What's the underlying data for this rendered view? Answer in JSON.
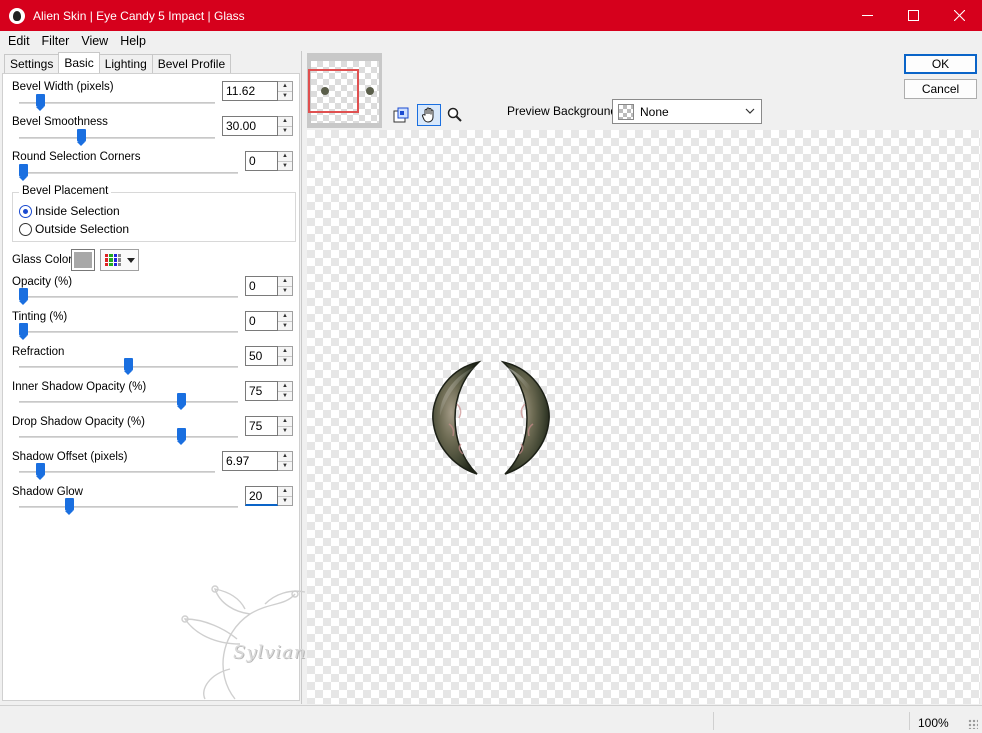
{
  "window": {
    "title": "Alien Skin | Eye Candy 5 Impact | Glass",
    "minimize_icon": "minimize-icon",
    "maximize_icon": "maximize-icon",
    "close_icon": "close-icon",
    "accent_color": "#d6001c"
  },
  "menu": [
    "Edit",
    "Filter",
    "View",
    "Help"
  ],
  "tabs": [
    "Settings",
    "Basic",
    "Lighting",
    "Bevel Profile"
  ],
  "active_tab": "Basic",
  "controls": {
    "bevel_width": {
      "label": "Bevel Width (pixels)",
      "value": "11.62"
    },
    "bevel_smoothness": {
      "label": "Bevel Smoothness",
      "value": "30.00"
    },
    "round_corners": {
      "label": "Round Selection Corners",
      "value": "0"
    },
    "bevel_placement": {
      "label": "Bevel Placement",
      "inside": "Inside Selection",
      "outside": "Outside Selection",
      "selected": "Inside Selection"
    },
    "glass_color": {
      "label": "Glass Color",
      "value": "#a8a8a8"
    },
    "opacity": {
      "label": "Opacity (%)",
      "value": "0"
    },
    "tinting": {
      "label": "Tinting (%)",
      "value": "0"
    },
    "refraction": {
      "label": "Refraction",
      "value": "50"
    },
    "inner_shadow_opacity": {
      "label": "Inner Shadow Opacity (%)",
      "value": "75"
    },
    "drop_shadow_opacity": {
      "label": "Drop Shadow Opacity (%)",
      "value": "75"
    },
    "shadow_offset": {
      "label": "Shadow Offset (pixels)",
      "value": "6.97"
    },
    "shadow_glow": {
      "label": "Shadow Glow",
      "value": "20"
    }
  },
  "slider_fractions": {
    "bevel_width": 0.09,
    "bevel_smoothness": 0.31,
    "round_corners": 0.0,
    "opacity": 0.0,
    "tinting": 0.0,
    "refraction": 0.5,
    "inner_shadow_opacity": 0.75,
    "drop_shadow_opacity": 0.75,
    "shadow_offset": 0.09,
    "shadow_glow": 0.22
  },
  "watermark_text": "Sylviane",
  "buttons": {
    "ok": "OK",
    "cancel": "Cancel"
  },
  "preview": {
    "background_label": "Preview Background:",
    "background_value": "None",
    "tools": [
      "navigator-icon",
      "hand-icon",
      "zoom-icon"
    ],
    "active_tool": "hand-icon"
  },
  "status": {
    "zoom": "100%"
  }
}
